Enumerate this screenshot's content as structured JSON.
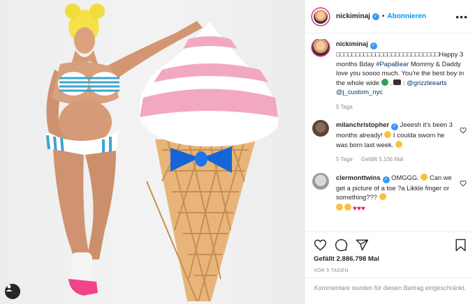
{
  "post": {
    "username": "nickiminaj",
    "follow_label": "Abonnieren",
    "more_label": "•••"
  },
  "caption": {
    "username": "nickiminaj",
    "squares": "□□□□□□□□□□□□□□□□□□□□□□□□□□",
    "text1": "Happy 3 months Bday ",
    "hashtag": "#PapaBear",
    "text2": " Mommy & Daddy love you soooo much. You're the best boy in the whole wide ",
    "text3": " . ",
    "mention1": "@grizzleearts",
    "mention2": "@j_custom_nyc",
    "time": "5 Tage"
  },
  "comments": [
    {
      "username": "milanchristopher",
      "text": " Jeeesh it's been 3 months already! ",
      "text2": " I coulda sworn he was born last week. ",
      "time": "5 Tage",
      "likes": "Gefällt 5.106 Mal"
    },
    {
      "username": "clermonttwins",
      "text": " OMGGG. ",
      "text2": " Can we get a picture of a toe ?a Likkle finger or something??? "
    }
  ],
  "likes_text": "Gefällt 2.886.798 Mal",
  "date_text": "VOR 5 TAGEN",
  "comments_closed": "Kommentare wurden für diesen Beitrag eingeschränkt.",
  "colors": {
    "link": "#00376b",
    "follow": "#0095f6",
    "verified": "#3897f0",
    "secondary_text": "#8e8e8e",
    "cone_pink": "#f3a8c2",
    "bow_blue": "#1565d8"
  },
  "icons": [
    "verified-icon",
    "more-icon",
    "heart-icon",
    "comment-icon",
    "share-icon",
    "bookmark-icon",
    "user-tag-icon"
  ]
}
